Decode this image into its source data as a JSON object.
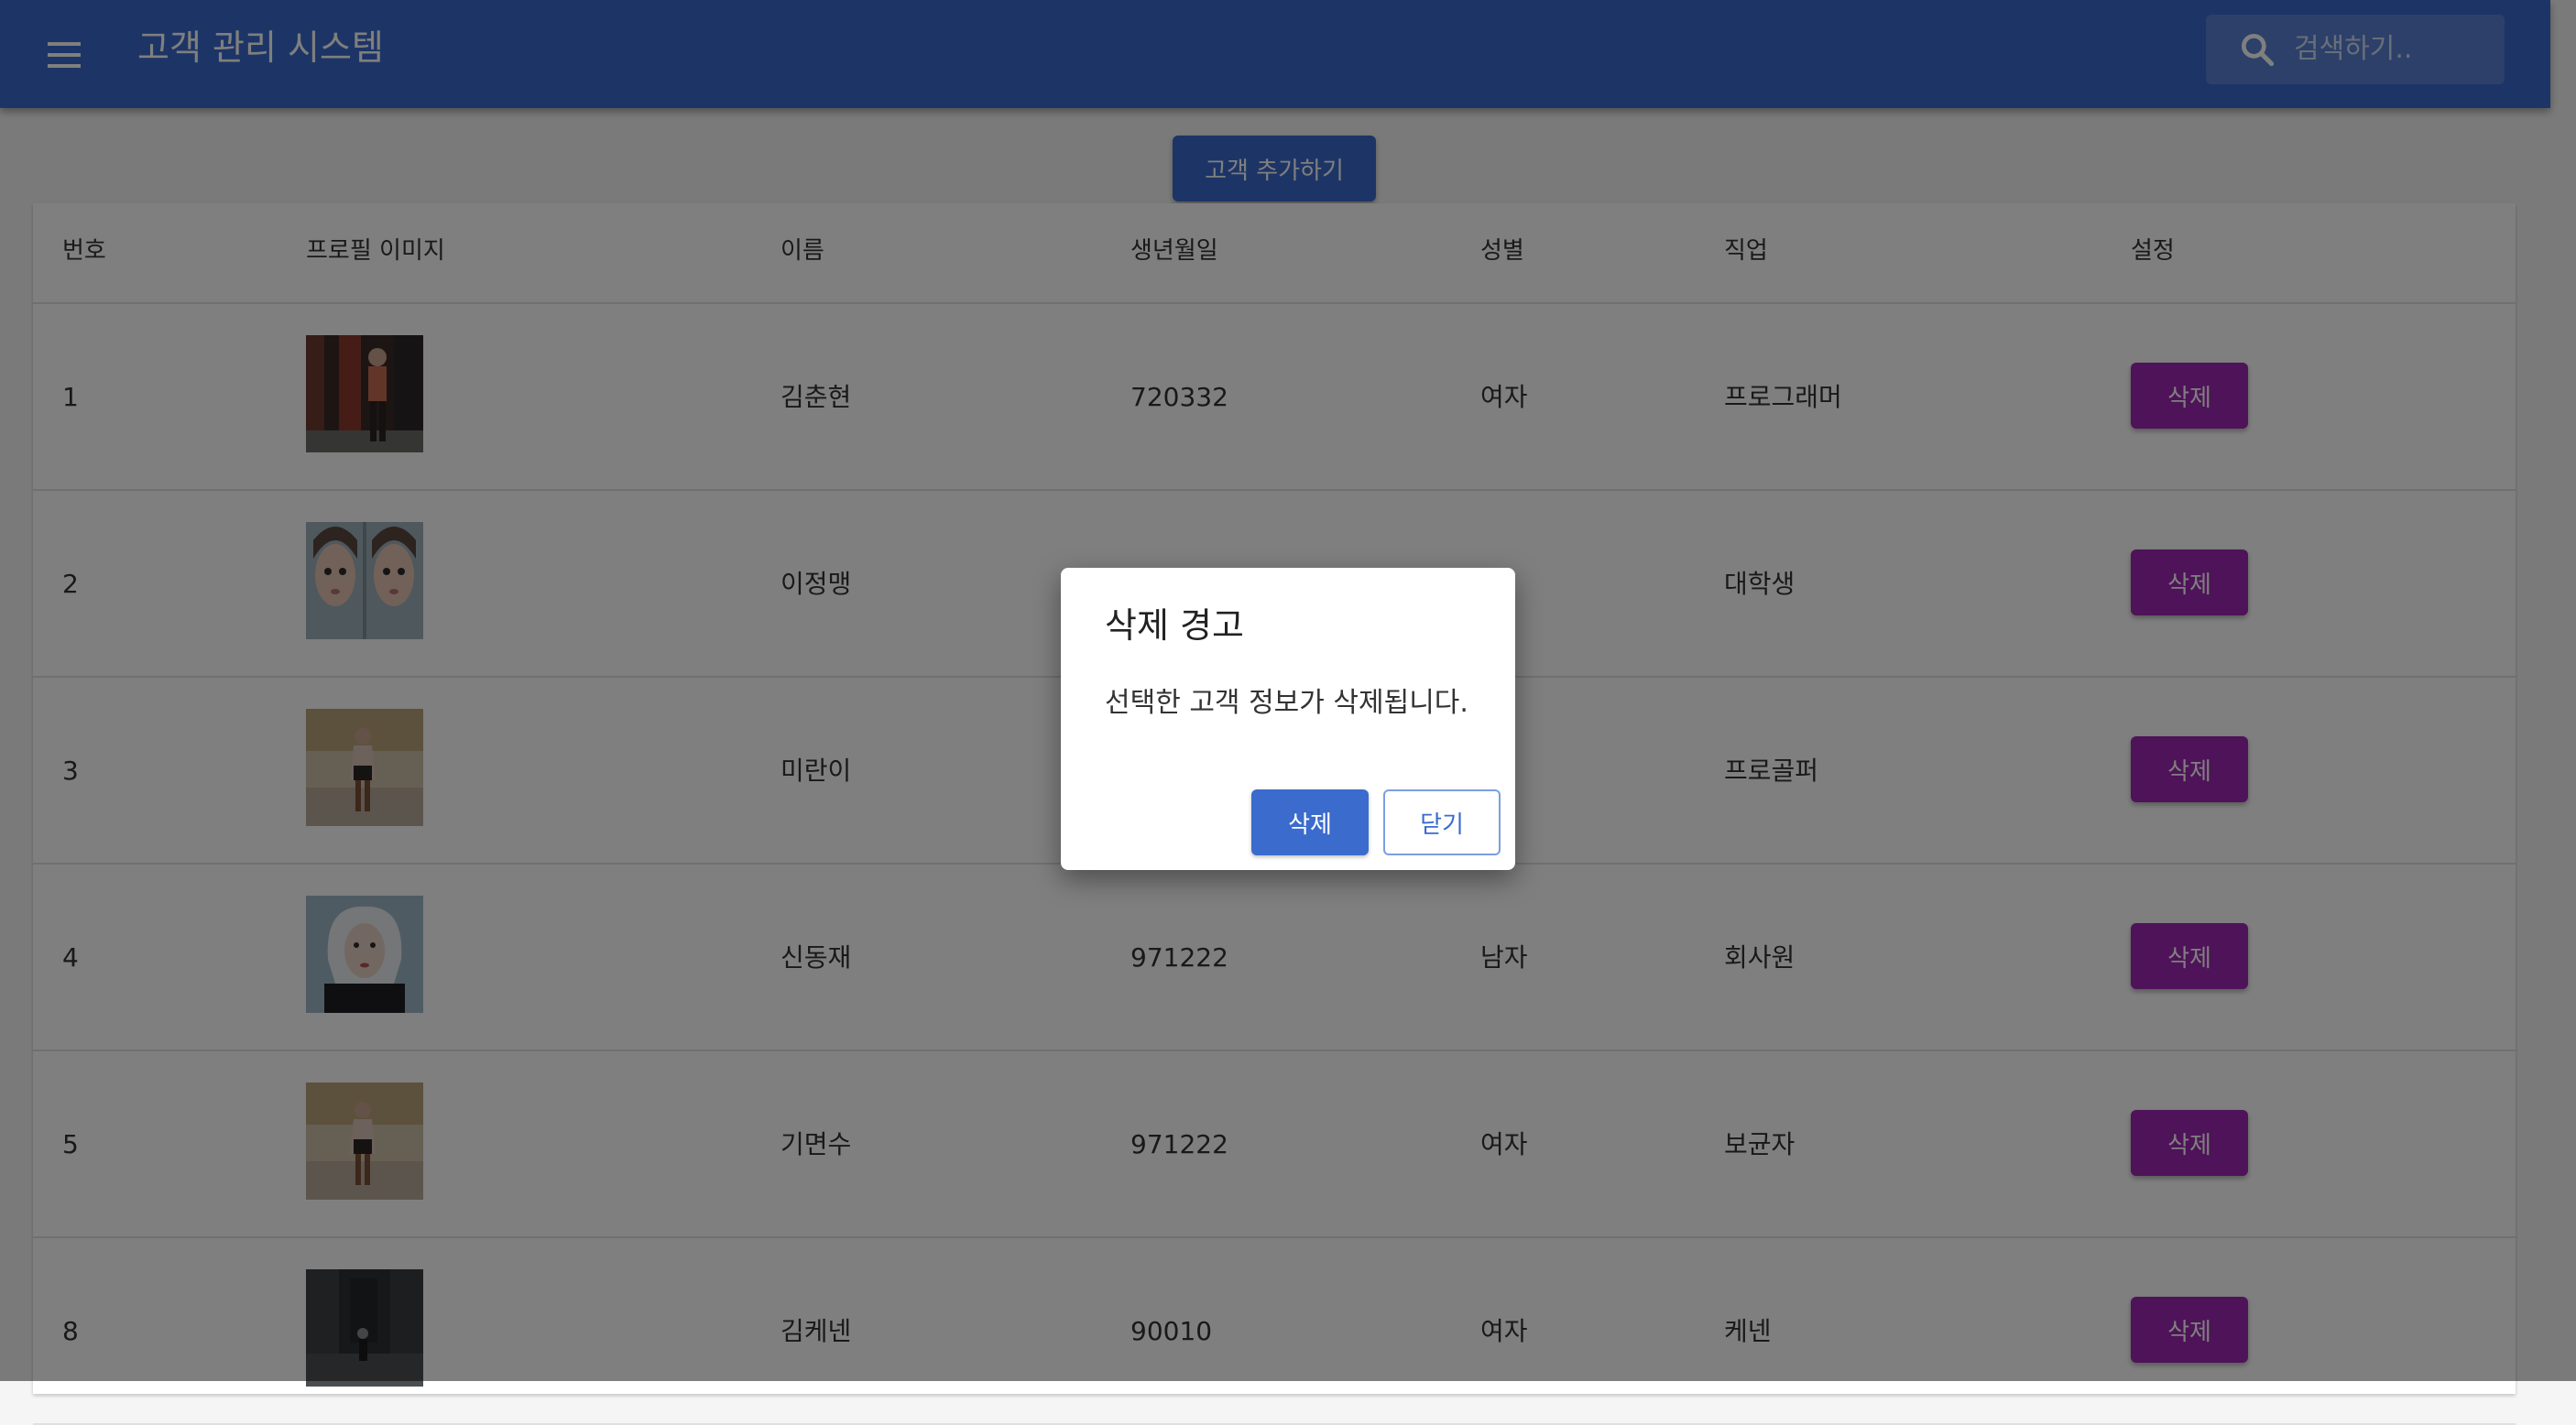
{
  "app": {
    "title": "고객 관리 시스템"
  },
  "search": {
    "placeholder": "검색하기.."
  },
  "toolbar": {
    "add_label": "고객 추가하기"
  },
  "table": {
    "headers": [
      "번호",
      "프로필 이미지",
      "이름",
      "생년월일",
      "성별",
      "직업",
      "설정"
    ],
    "rows": [
      {
        "id": "1",
        "name": "김춘현",
        "birthday": "720332",
        "gender": "여자",
        "job": "프로그래머",
        "action": "삭제"
      },
      {
        "id": "2",
        "name": "이정맹",
        "birthday": "",
        "gender": "",
        "job": "대학생",
        "action": "삭제"
      },
      {
        "id": "3",
        "name": "미란이",
        "birthday": "",
        "gender": "",
        "job": "프로골퍼",
        "action": "삭제"
      },
      {
        "id": "4",
        "name": "신동재",
        "birthday": "971222",
        "gender": "남자",
        "job": "회사원",
        "action": "삭제"
      },
      {
        "id": "5",
        "name": "기면수",
        "birthday": "971222",
        "gender": "여자",
        "job": "보균자",
        "action": "삭제"
      },
      {
        "id": "8",
        "name": "김케넨",
        "birthday": "90010",
        "gender": "여자",
        "job": "케넨",
        "action": "삭제"
      }
    ]
  },
  "dialog": {
    "title": "삭제 경고",
    "message": "선택한 고객 정보가 삭제됩니다.",
    "confirm_label": "삭제",
    "close_label": "닫기"
  },
  "colors": {
    "appbar": "#3b6bcc",
    "delete_button": "#9c27b0",
    "overlay": "rgba(0,0,0,0.5)"
  }
}
